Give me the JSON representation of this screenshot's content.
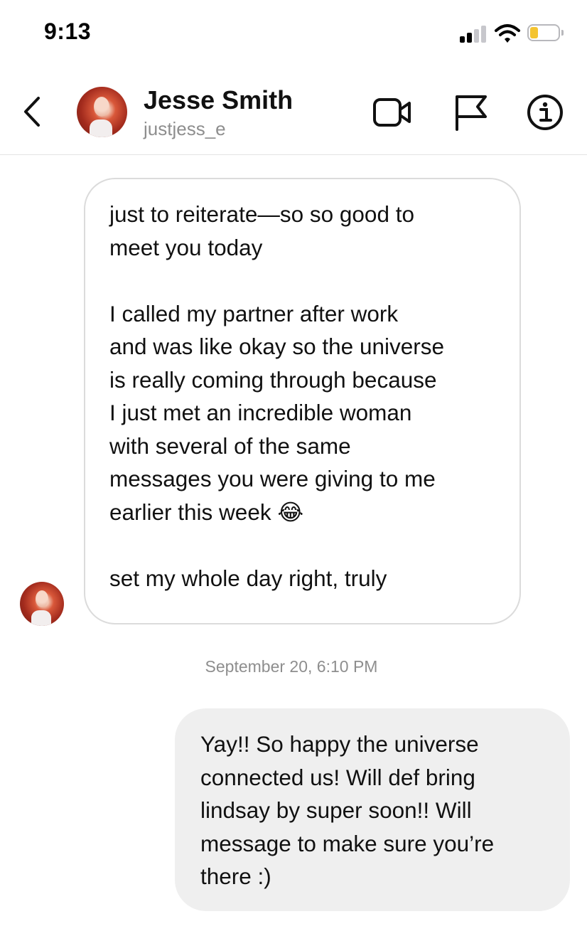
{
  "status_bar": {
    "time": "9:13",
    "signal_icon": "cellular-signal-icon",
    "wifi_icon": "wifi-icon",
    "battery_icon": "battery-icon",
    "battery_level": 0.3,
    "battery_color": "#f4c430"
  },
  "header": {
    "back_icon": "chevron-left-icon",
    "name": "Jesse Smith",
    "username": "justjess_e",
    "video_icon": "video-camera-icon",
    "flag_icon": "flag-icon",
    "info_icon": "info-icon"
  },
  "messages": {
    "incoming": [
      {
        "text": "just to reiterate—so so good to\nmeet you today\n\nI called my partner after work\nand was like okay so the universe\nis really coming through because\nI just met an incredible woman\nwith several of the same\nmessages you were giving to me\nearlier this week 😂\n\nset my whole day right, truly"
      }
    ],
    "timestamp": "September 20, 6:10 PM",
    "outgoing": [
      {
        "text": "Yay!! So happy the universe\nconnected us! Will def bring\nlindsay by super soon!! Will\nmessage to make sure you’re\nthere :)"
      }
    ]
  },
  "colors": {
    "outgoing_bubble": "#efefef",
    "incoming_border": "#dbdbdb",
    "secondary_text": "#8e8e8e"
  }
}
